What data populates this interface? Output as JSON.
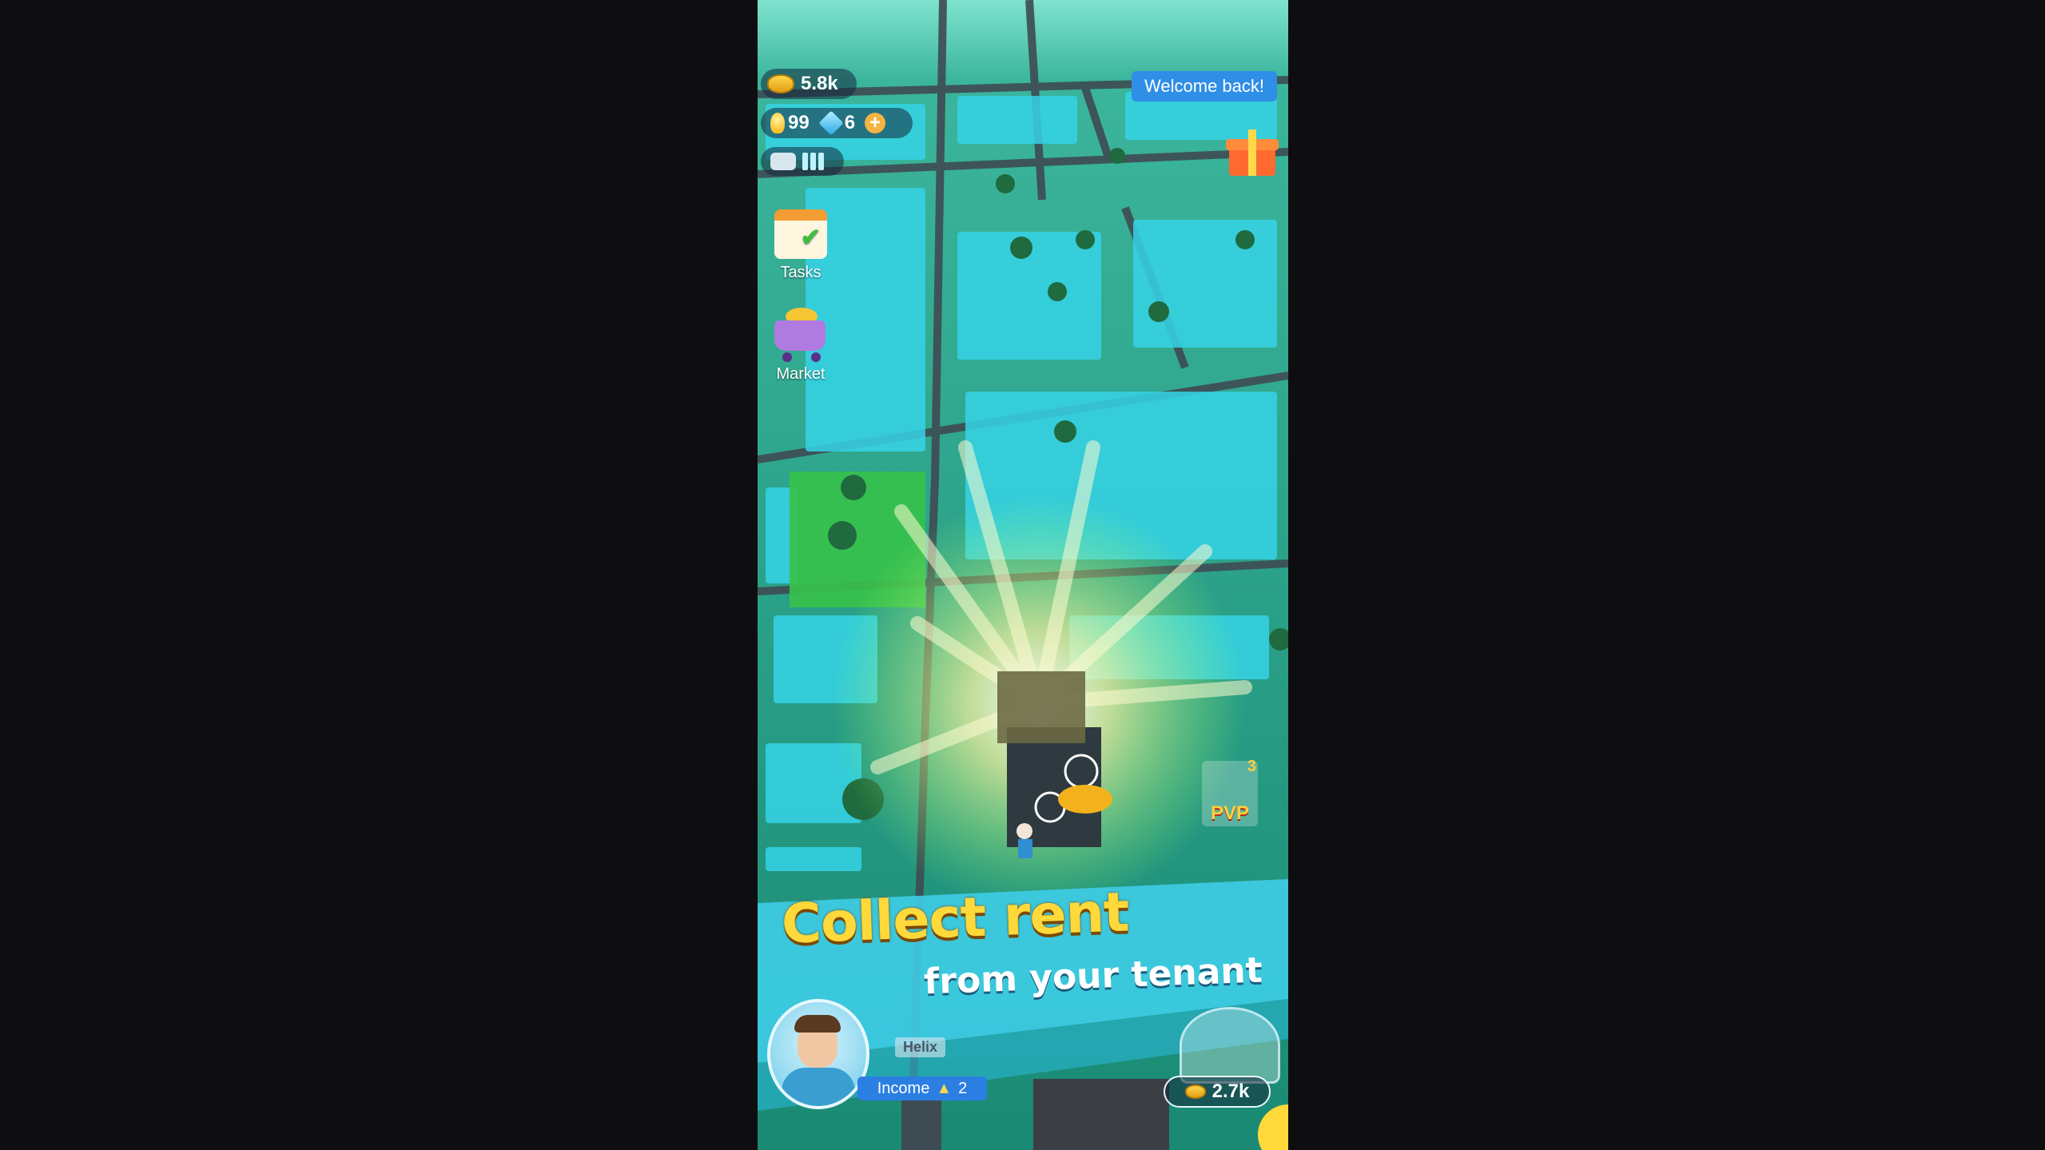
{
  "hud": {
    "coins": "5.8k",
    "ideas": "99",
    "gems": "6",
    "plus_icon": "plus-icon",
    "drone_icon": "drone-icon",
    "capacity_icon": "bars-icon"
  },
  "welcome_message": "Welcome back!",
  "side_menu": [
    {
      "label": "Tasks",
      "icon": "calendar-check-icon"
    },
    {
      "label": "Market",
      "icon": "shopping-cart-icon"
    }
  ],
  "gift_icon": "gift-box-icon",
  "pvp": {
    "label": "PVP",
    "count": "3"
  },
  "promo": {
    "headline": "Collect rent",
    "subline": "from your tenant"
  },
  "player": {
    "name": "Helix",
    "income_label": "Income",
    "income_level": "2"
  },
  "building": {
    "coin_value": "2.7k"
  },
  "colors": {
    "map_green": "#1a8a74",
    "building_cyan": "#35d4e6",
    "headline_yellow": "#ffd93a",
    "income_blue": "#2b7fe3",
    "welcome_blue": "#2f8ee6"
  }
}
